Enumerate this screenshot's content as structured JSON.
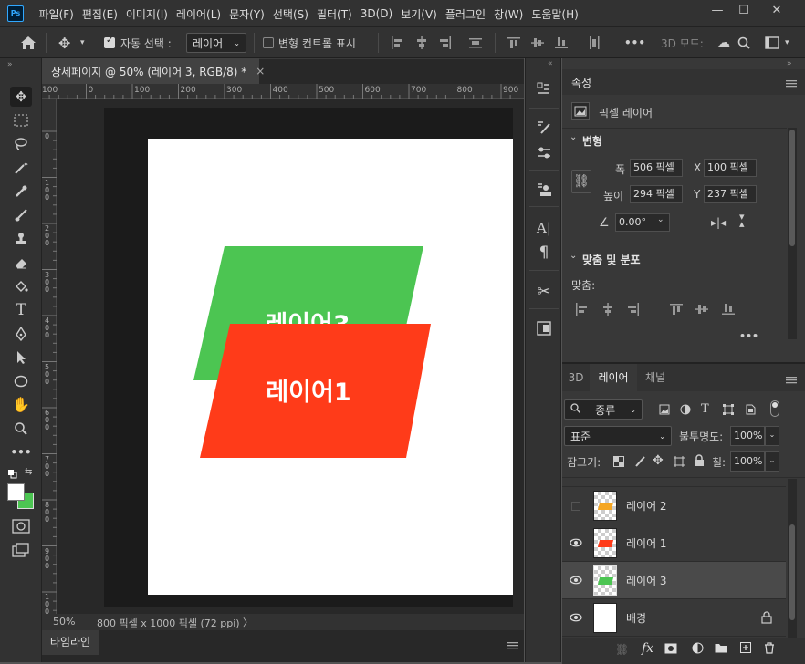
{
  "app": {
    "logo": "Ps"
  },
  "menu": [
    "파일(F)",
    "편집(E)",
    "이미지(I)",
    "레이어(L)",
    "문자(Y)",
    "선택(S)",
    "필터(T)",
    "3D(D)",
    "보기(V)",
    "플러그인",
    "창(W)",
    "도움말(H)"
  ],
  "window_controls": {
    "minimize": "—",
    "maximize": "☐",
    "close": "✕"
  },
  "options": {
    "auto_select_label": "자동 선택 :",
    "auto_select_value": "레이어",
    "transform_controls_label": "변형 컨트롤 표시",
    "mode_3d_label": "3D 모드:",
    "more": "•••"
  },
  "document": {
    "tab_title": "상세페이지 @ 50% (레이어 3, RGB/8) *",
    "tab_close": "×",
    "zoom": "50%",
    "info": "800 픽셀 x 1000 픽셀 (72 ppi)",
    "info_arrow": "〉",
    "ruler_h": [
      "100",
      "0",
      "100",
      "200",
      "300",
      "400",
      "500",
      "600",
      "700",
      "800",
      "900"
    ],
    "ruler_v": [
      "0",
      "1 0 0",
      "2 0 0",
      "3 0 0",
      "4 0 0",
      "5 0 0",
      "6 0 0",
      "7 0 0",
      "8 0 0",
      "9 0 0",
      "1 0 0 0"
    ],
    "shape_green_text": "레이어3",
    "shape_red_text": "레이어1",
    "colors": {
      "green": "#4cc552",
      "red": "#ff3b19",
      "orange": "#f5a623"
    }
  },
  "timeline": {
    "tab": "타임라인"
  },
  "properties": {
    "tab": "속성",
    "layer_type": "픽셀 레이어",
    "transform_title": "변형",
    "w_label": "폭",
    "w_value": "506 픽셀",
    "h_label": "높이",
    "h_value": "294 픽셀",
    "x_label": "X",
    "x_value": "100 픽셀",
    "y_label": "Y",
    "y_value": "237 픽셀",
    "angle_value": "0.00°",
    "align_title": "맞춤 및 분포",
    "align_label": "맞춤:",
    "more": "•••"
  },
  "layers_panel": {
    "tabs": [
      "3D",
      "레이어",
      "채널"
    ],
    "filter_label": "종류",
    "blend_mode": "표준",
    "opacity_label": "불투명도:",
    "opacity_value": "100%",
    "lock_label": "잠그기:",
    "fill_label": "칠:",
    "fill_value": "100%",
    "layers": [
      {
        "name": "레이어 2",
        "visible": false,
        "color": "#f5a623",
        "selected": false
      },
      {
        "name": "레이어 1",
        "visible": true,
        "color": "#ff3b19",
        "selected": false
      },
      {
        "name": "레이어 3",
        "visible": true,
        "color": "#4cc552",
        "selected": true
      },
      {
        "name": "배경",
        "visible": true,
        "color": "#ffffff",
        "selected": false,
        "locked": true
      }
    ],
    "footer_fx": "fx"
  }
}
